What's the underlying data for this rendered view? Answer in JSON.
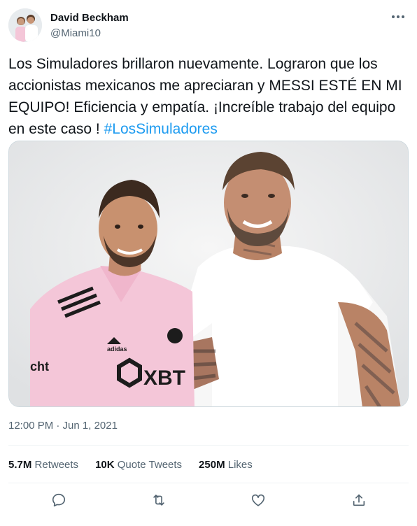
{
  "author": {
    "name": "David Beckham",
    "handle": "@Miami10"
  },
  "tweet": {
    "text": "Los Simuladores brillaron nuevamente. Lograron que los accionistas mexicanos me apreciaran y MESSI ESTÉ EN MI EQUIPO! Eficiencia y empatía. ¡Increíble trabajo del equipo en este caso ! ",
    "hashtag": "#LosSimuladores",
    "timestamp": "12:00 PM · Jun 1, 2021"
  },
  "stats": {
    "retweets_count": "5.7M",
    "retweets_label": "Retweets",
    "quotes_count": "10K",
    "quotes_label": "Quote Tweets",
    "likes_count": "250M",
    "likes_label": "Likes"
  },
  "photo": {
    "jersey_text": "XBT",
    "jersey_side_text": "cht"
  },
  "icons": [
    "more-icon",
    "reply-icon",
    "retweet-icon",
    "like-icon",
    "share-icon"
  ],
  "colors": {
    "accent": "#1d9bf0",
    "text": "#0f1419",
    "secondary": "#536471",
    "jersey_pink": "#f4c6d8"
  }
}
